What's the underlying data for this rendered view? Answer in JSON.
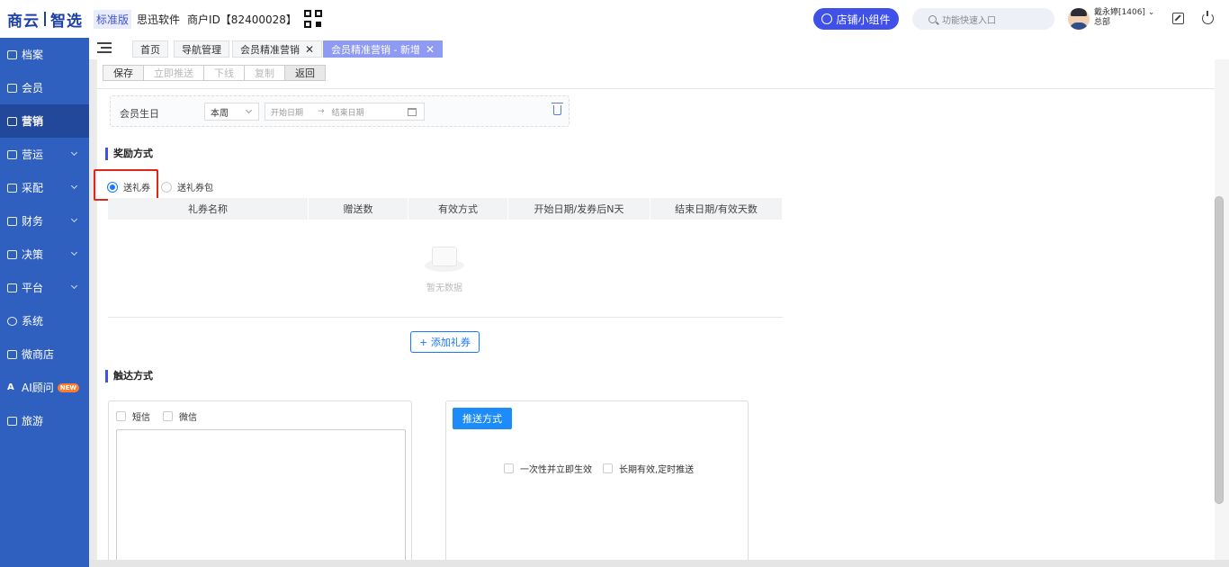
{
  "header": {
    "logo_left": "商云",
    "logo_right": "智选",
    "edition": "标准版",
    "company": "思迅软件",
    "merchant": "商户ID【82400028】",
    "store_widget_button": "店铺小组件",
    "search_placeholder": "功能快速入口",
    "user_name": "戴永婷[1406]",
    "user_role": "总部",
    "accent_color": "#3f51e8"
  },
  "sidebar": {
    "items": [
      {
        "label": "档案",
        "icon": "archive-icon"
      },
      {
        "label": "会员",
        "icon": "user-icon"
      },
      {
        "label": "营销",
        "icon": "marketing-icon"
      },
      {
        "label": "营运",
        "icon": "operations-icon"
      },
      {
        "label": "采配",
        "icon": "purchase-icon"
      },
      {
        "label": "财务",
        "icon": "finance-icon"
      },
      {
        "label": "决策",
        "icon": "decision-icon"
      },
      {
        "label": "平台",
        "icon": "platform-icon"
      },
      {
        "label": "系统",
        "icon": "system-icon"
      },
      {
        "label": "微商店",
        "icon": "shop-icon"
      },
      {
        "label": "AI顾问",
        "icon": "ai-icon",
        "badge": "NEW"
      },
      {
        "label": "旅游",
        "icon": "travel-icon"
      }
    ],
    "active": "营销",
    "background": "#2f5fbf"
  },
  "tabs": [
    {
      "label": "首页"
    },
    {
      "label": "导航管理"
    },
    {
      "label": "会员精准营销",
      "close": "✕"
    },
    {
      "label": "会员精准营销 - 新增",
      "close": "✕"
    }
  ],
  "toolbar": {
    "save": "保存",
    "push_now": "立即推送",
    "offline": "下线",
    "copy": "复制",
    "back": "返回"
  },
  "filter": {
    "label": "会员生日",
    "period": "本周",
    "start_placeholder": "开始日期",
    "end_placeholder": "结束日期",
    "range_arrow": "→"
  },
  "reward": {
    "title": "奖励方式",
    "option_coupon": "送礼券",
    "option_coupon_pack": "送礼券包",
    "selected": "送礼券",
    "columns": [
      "礼券名称",
      "赠送数",
      "有效方式",
      "开始日期/发券后N天",
      "结束日期/有效天数"
    ],
    "empty_text": "暂无数据",
    "add_button": "+ 添加礼券"
  },
  "reach": {
    "title": "触达方式",
    "sms": "短信",
    "wechat": "微信",
    "push_method_button": "推送方式",
    "once_immediate": "一次性并立即生效",
    "long_term_scheduled": "长期有效,定时推送"
  }
}
